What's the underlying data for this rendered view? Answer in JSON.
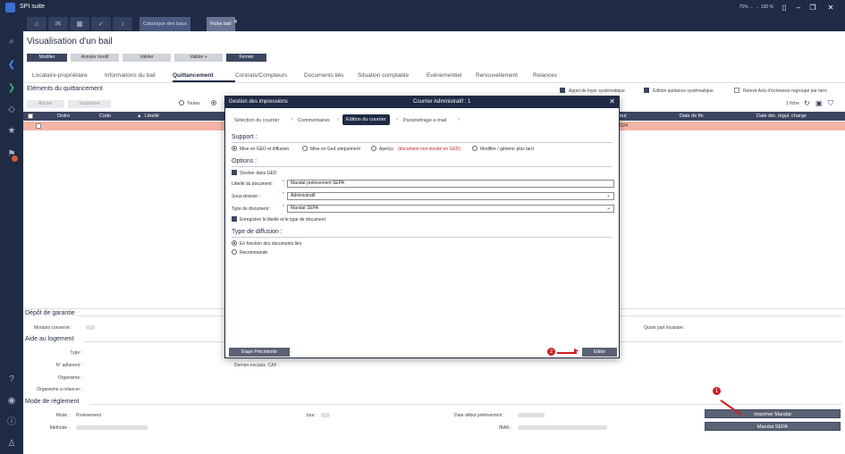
{
  "app": {
    "title": "SPI suite",
    "window_info": "75% ← → 100 %"
  },
  "tabs": {
    "doc1": "Catalogue des baux",
    "doc2": "Fiche bail"
  },
  "page": {
    "title": "Visualisation d'un bail",
    "subtitle": "",
    "toolbar": [
      "Modifier",
      "Annuler modif",
      "Valider",
      "Valider +",
      "Fermer"
    ],
    "nav": [
      "Locataire-propriétaire",
      "Informations du bail",
      "Quittancement",
      "Contrats/Compteurs",
      "Documents liés",
      "Situation comptable",
      "Evénementiel",
      "Renouvellement",
      "Relances"
    ]
  },
  "quittancement": {
    "section_title": "Eléments du quittancement",
    "add": "Ajouter",
    "delete": "Supprimer",
    "filter_all": "Toutes",
    "opt1": "Appel de loyer systématique",
    "opt2": "Edition quittance systématique",
    "opt3": "Relevé Avis d'échéance regroupé par tiers",
    "count": "1 fiche",
    "columns": [
      "Ordre",
      "Code",
      "Libellé",
      "but",
      "Date de fin",
      "Date der. régul. charge"
    ],
    "row_date": "024"
  },
  "depot": {
    "title": "Dépôt de garantie",
    "montant": "Montant conservé :",
    "quote": "Quote part locataire :"
  },
  "aide": {
    "title": "Aide au logement",
    "type": "Type :",
    "adherent": "N° adhérent :",
    "organisme": "Organisme :",
    "relancer": "Organisme à relancer :",
    "caf": "Dernier encaiss. CAF :"
  },
  "reglement": {
    "title": "Mode de règlement",
    "mode_lbl": "Mode :",
    "mode_val": "Prelevement",
    "methode_lbl": "Méthode :",
    "jour_lbl": "Jour :",
    "date_lbl": "Date début prélèvement :",
    "iban_lbl": "IBAN :",
    "btn_imprimer": "Imprimer Mandat",
    "btn_mandat": "Mandat SEPA"
  },
  "modal": {
    "title": "Gestion des impressions",
    "center": "Courrier Administratif : 1",
    "steps": [
      "Sélection du courrier",
      "Commentaires",
      "Edition du courrier",
      "Paramétrage e-mail"
    ],
    "support_title": "Support :",
    "support_opts": [
      "Mise en GED et diffusion",
      "Mise en Ged uniquement",
      "Aperçu",
      "Modifier / générer plus tard"
    ],
    "apercu_note": "(document non stocké en GED)",
    "options_title": "Options :",
    "stocker": "Stocker dans GED",
    "libelle_lbl": "Libellé du document :",
    "libelle_val": "Mandat prelevement SEPA",
    "sousdossier_lbl": "Sous-dossier :",
    "sousdossier_val": "Administratif",
    "type_lbl": "Type de document :",
    "type_val": "Mandat SEPA",
    "enregistrer": "Enregistrer le libellé et le type de document",
    "diffusion_title": "Type de diffusion :",
    "diffusion_opts": [
      "En fonction des documents liés",
      "Recommandé"
    ],
    "btn_prev": "Etape Précédente",
    "btn_edit": "Editer"
  },
  "callouts": {
    "c1": "1",
    "c2": "2"
  },
  "colors": {
    "navy": "#1f2a44",
    "highlight_row": "#f4b4a6",
    "callout": "#d11e1e"
  }
}
